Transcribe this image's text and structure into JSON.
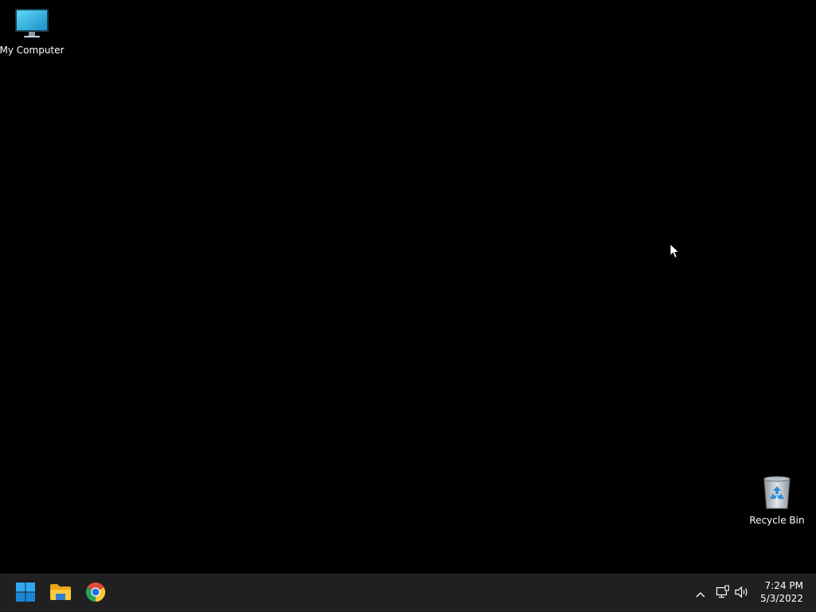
{
  "desktop": {
    "background_color": "#000000",
    "icons": [
      {
        "label": "My Computer",
        "icon": "computer-monitor-icon"
      },
      {
        "label": "Recycle Bin",
        "icon": "recycle-bin-icon"
      }
    ]
  },
  "taskbar": {
    "background_color": "#202020",
    "pinned": [
      {
        "name": "Start",
        "icon": "windows-start-icon"
      },
      {
        "name": "File Explorer",
        "icon": "folder-icon"
      },
      {
        "name": "Google Chrome",
        "icon": "chrome-icon"
      }
    ],
    "tray": {
      "icons": [
        "chevron-up-icon",
        "network-icon",
        "speaker-icon"
      ],
      "time": "7:24 PM",
      "date": "5/3/2022"
    }
  }
}
